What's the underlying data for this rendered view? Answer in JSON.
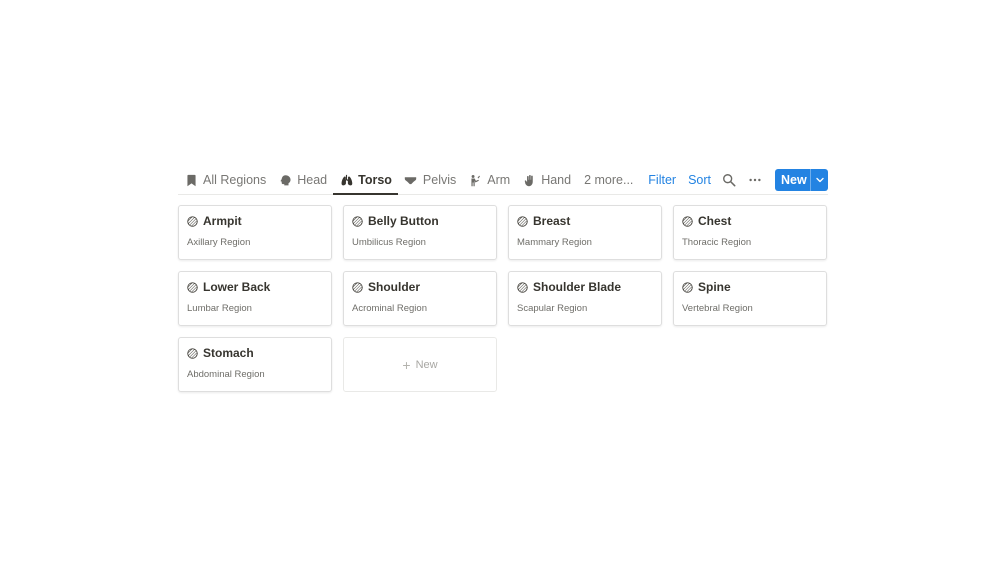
{
  "tabs": [
    {
      "label": "All Regions",
      "icon": "bookmark-icon",
      "active": false
    },
    {
      "label": "Head",
      "icon": "head-icon",
      "active": false
    },
    {
      "label": "Torso",
      "icon": "lungs-icon",
      "active": true
    },
    {
      "label": "Pelvis",
      "icon": "pelvis-icon",
      "active": false
    },
    {
      "label": "Arm",
      "icon": "arm-icon",
      "active": false
    },
    {
      "label": "Hand",
      "icon": "hand-icon",
      "active": false
    }
  ],
  "more_tabs_label": "2 more...",
  "toolbar": {
    "filter_label": "Filter",
    "sort_label": "Sort",
    "search_icon": "search-icon",
    "more_icon": "more-icon",
    "new_label": "New"
  },
  "cards": [
    {
      "title": "Armpit",
      "subtitle": "Axillary Region"
    },
    {
      "title": "Belly Button",
      "subtitle": "Umbilicus Region"
    },
    {
      "title": "Breast",
      "subtitle": "Mammary Region"
    },
    {
      "title": "Chest",
      "subtitle": "Thoracic Region"
    },
    {
      "title": "Lower Back",
      "subtitle": "Lumbar Region"
    },
    {
      "title": "Shoulder",
      "subtitle": "Acrominal Region"
    },
    {
      "title": "Shoulder Blade",
      "subtitle": "Scapular Region"
    },
    {
      "title": "Spine",
      "subtitle": "Vertebral Region"
    },
    {
      "title": "Stomach",
      "subtitle": "Abdominal Region"
    }
  ],
  "new_card_label": "New",
  "colors": {
    "accent": "#2383e2",
    "text": "#37352f",
    "muted": "#787774",
    "border": "#dedede"
  }
}
